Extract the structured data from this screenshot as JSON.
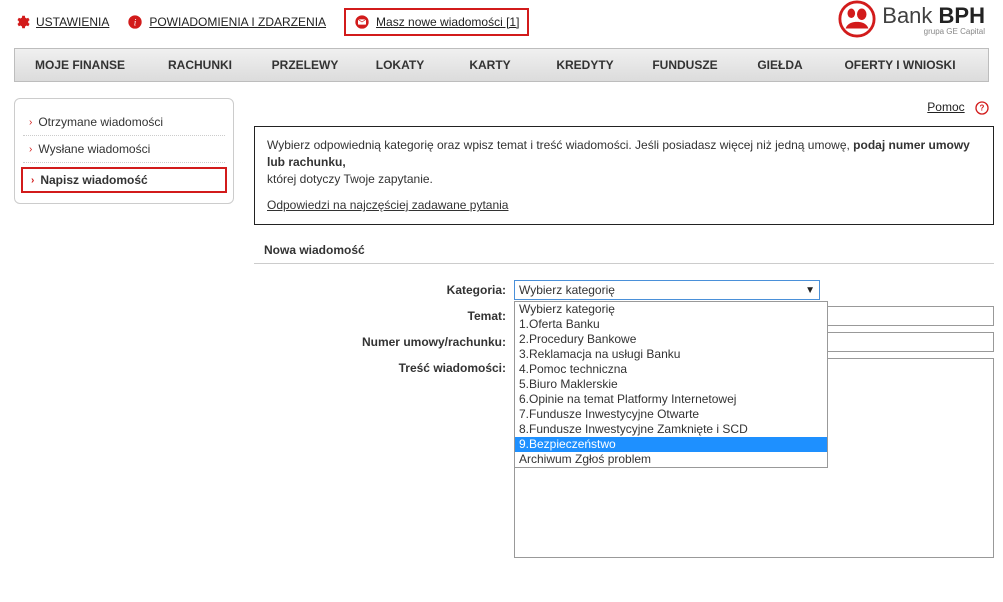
{
  "header": {
    "settings": "USTAWIENIA",
    "notifications": "POWIADOMIENIA I ZDARZENIA",
    "newMessages": "Masz nowe wiadomości [1]"
  },
  "logo": {
    "text1": "Bank",
    "text2": "BPH",
    "sub": "grupa GE Capital"
  },
  "nav": [
    "MOJE FINANSE",
    "RACHUNKI",
    "PRZELEWY",
    "LOKATY",
    "KARTY",
    "KREDYTY",
    "FUNDUSZE",
    "GIEŁDA",
    "OFERTY I WNIOSKI"
  ],
  "navWidths": [
    130,
    110,
    100,
    90,
    90,
    100,
    100,
    90,
    150
  ],
  "sidebar": {
    "items": [
      "Otrzymane wiadomości",
      "Wysłane wiadomości",
      "Napisz wiadomość"
    ]
  },
  "help": {
    "label": "Pomoc"
  },
  "infobox": {
    "line1a": "Wybierz odpowiednią kategorię oraz wpisz temat i treść wiadomości. Jeśli posiadasz więcej niż jedną umowę, ",
    "line1bold": "podaj numer umowy lub rachunku,",
    "line2": "której dotyczy Twoje zapytanie.",
    "faq": "Odpowiedzi na najczęściej zadawane pytania"
  },
  "section": {
    "title": "Nowa wiadomość"
  },
  "form": {
    "labels": {
      "category": "Kategoria:",
      "subject": "Temat:",
      "accountNo": "Numer umowy/rachunku:",
      "body": "Treść wiadomości:"
    },
    "selectedCategory": "Wybierz kategorię",
    "dropdown": [
      "Wybierz kategorię",
      "1.Oferta Banku",
      "2.Procedury Bankowe",
      "3.Reklamacja na usługi Banku",
      "4.Pomoc techniczna",
      "5.Biuro Maklerskie",
      "6.Opinie na temat Platformy Internetowej",
      "7.Fundusze Inwestycyjne Otwarte",
      "8.Fundusze Inwestycyjne Zamknięte i SCD",
      "9.Bezpieczeństwo",
      "Archiwum Zgłoś problem"
    ],
    "highlightedOptionIndex": 9
  }
}
